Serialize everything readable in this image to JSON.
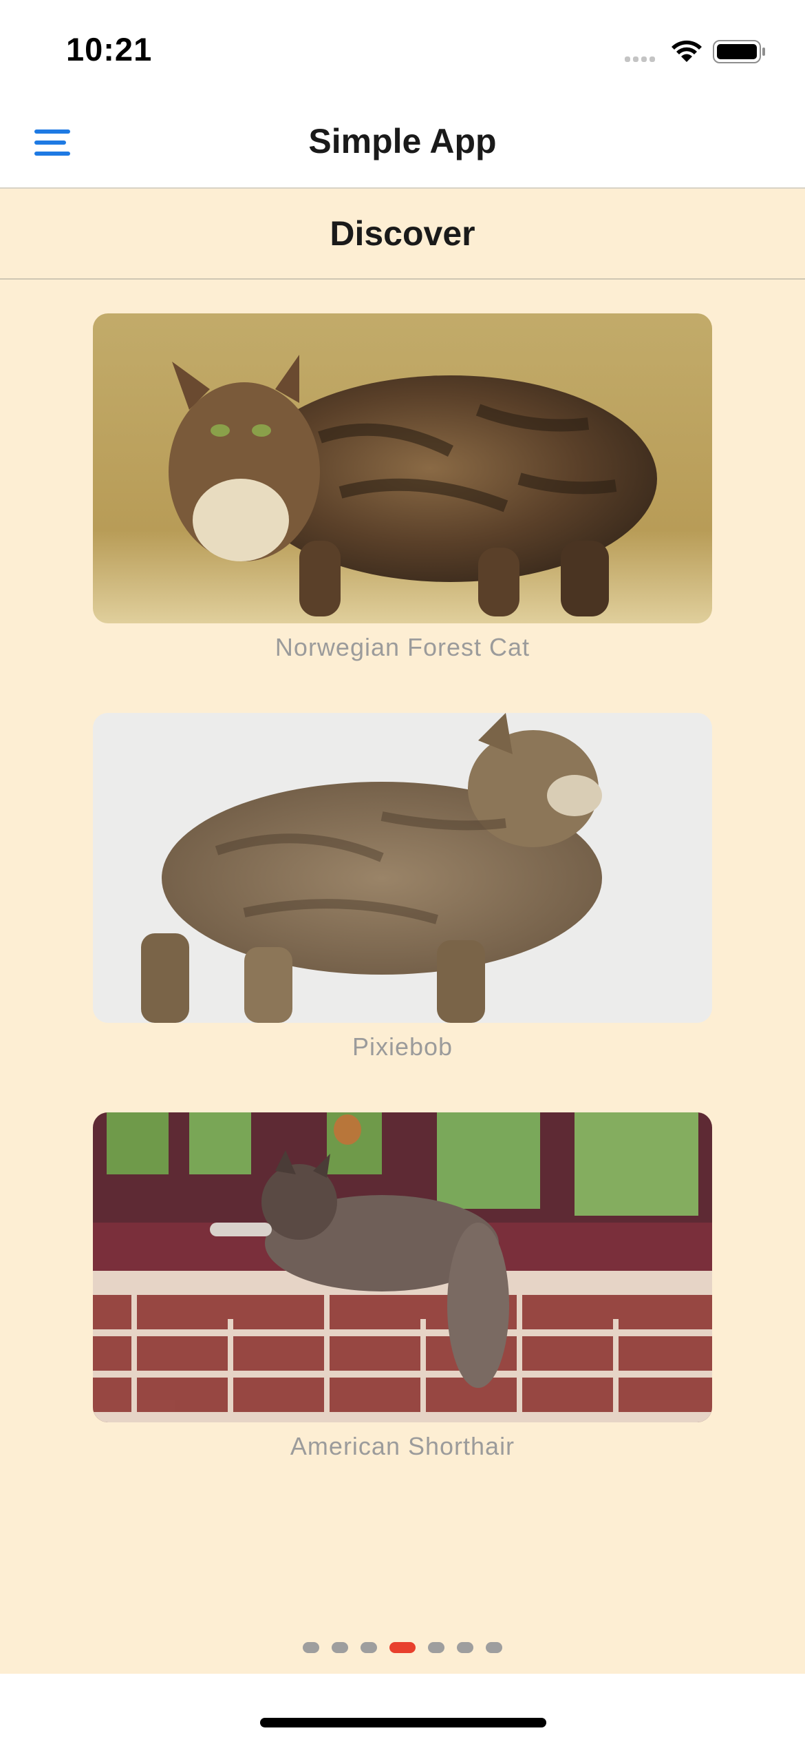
{
  "status_bar": {
    "time": "10:21"
  },
  "nav": {
    "title": "Simple App",
    "menu_icon": "hamburger-menu-icon",
    "accent_color": "#1e7ae3"
  },
  "section": {
    "title": "Discover",
    "background_color": "#fdeed3"
  },
  "cards": [
    {
      "caption": "Norwegian Forest Cat",
      "image": "photo of a long-haired tabby cat on a beige backdrop"
    },
    {
      "caption": "Pixiebob",
      "image": "photo of a short-tailed brown tabby cat on a white backdrop"
    },
    {
      "caption": "American Shorthair",
      "image": "photo of a fluffy cat lying on a red window sill"
    }
  ],
  "pager": {
    "total_pages": 7,
    "active_index": 3,
    "active_color": "#e8402d"
  }
}
